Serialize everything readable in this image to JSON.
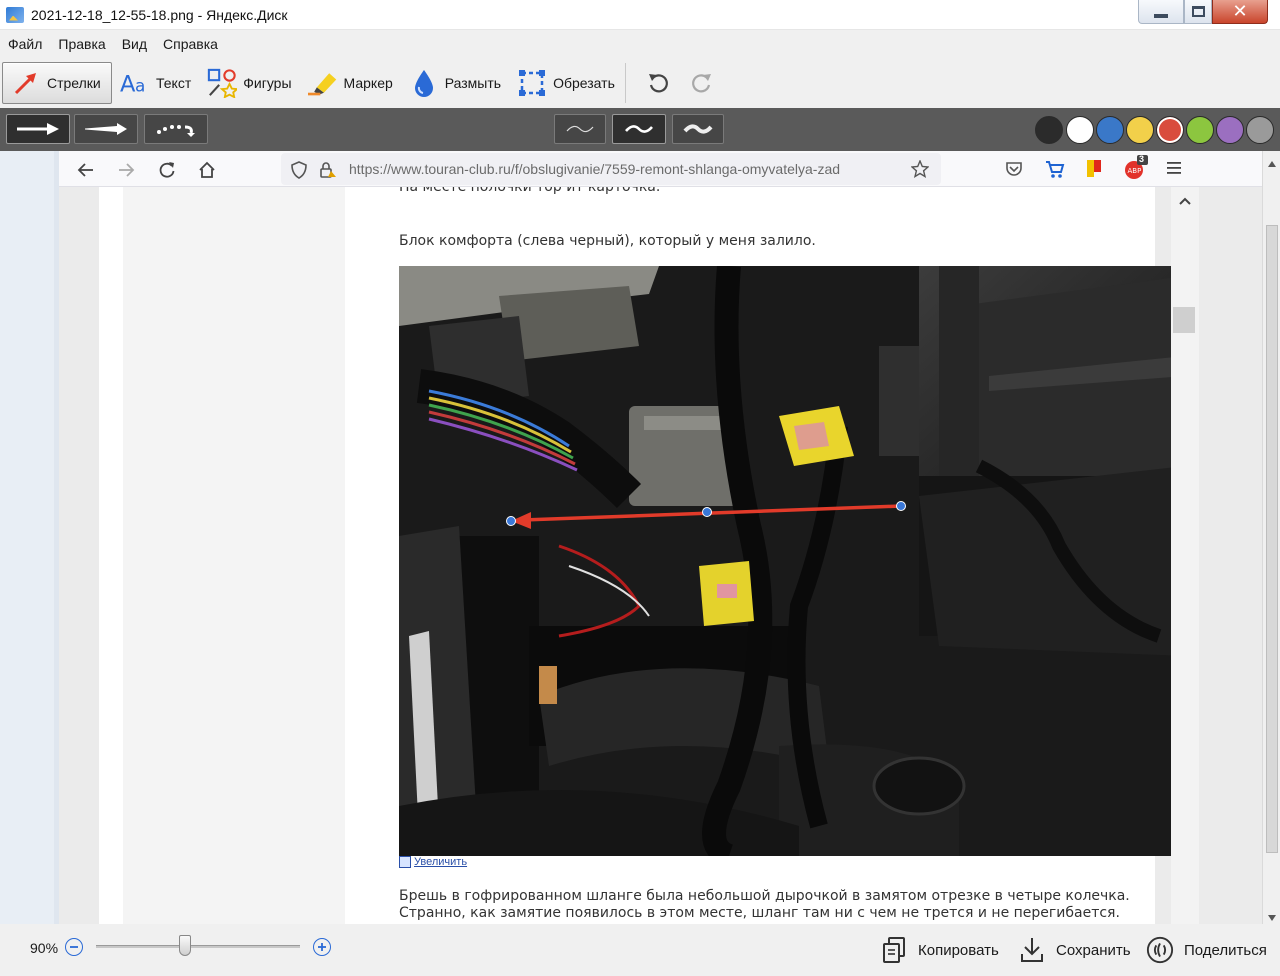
{
  "window": {
    "title": "2021-12-18_12-55-18.png - Яндекс.Диск",
    "close_glyph": "✕"
  },
  "menu": [
    "Файл",
    "Правка",
    "Вид",
    "Справка"
  ],
  "tools": [
    {
      "label": "Стрелки",
      "icon": "arrow-tool-icon",
      "active": true
    },
    {
      "label": "Текст",
      "icon": "text-tool-icon",
      "active": false
    },
    {
      "label": "Фигуры",
      "icon": "shapes-tool-icon",
      "active": false
    },
    {
      "label": "Маркер",
      "icon": "marker-tool-icon",
      "active": false
    },
    {
      "label": "Размыть",
      "icon": "blur-tool-icon",
      "active": false
    },
    {
      "label": "Обрезать",
      "icon": "crop-tool-icon",
      "active": false
    }
  ],
  "history": [
    "undo-icon",
    "redo-icon"
  ],
  "colors": [
    "#2b2b2b",
    "#ffffff",
    "#3a78c8",
    "#f2d04a",
    "#d94c3d",
    "#8cc63f",
    "#9b6fc0",
    "#9a9a9a"
  ],
  "selected_color": "#d94c3d",
  "browser": {
    "url": "https://www.touran-club.ru/f/obslugivanie/7559-remont-shlanga-omyvatelya-zad",
    "badge_count": "3"
  },
  "page": {
    "cut_line": "На месте полочки тор ит карточка.",
    "caption": "Блок комфорта (слева черный), который у меня залило.",
    "enlarge_link": "Увеличить",
    "para1": "Брешь в гофрированном шланге была небольшой дырочкой в замятом отрезке в четыре колечка.",
    "para2": "Странно, как замятие появилось в этом месте, шланг там ни с чем не трется и не перегибается."
  },
  "status": {
    "zoom": "90%",
    "copy_label": "Копировать",
    "save_label": "Сохранить",
    "share_label": "Поделиться"
  }
}
